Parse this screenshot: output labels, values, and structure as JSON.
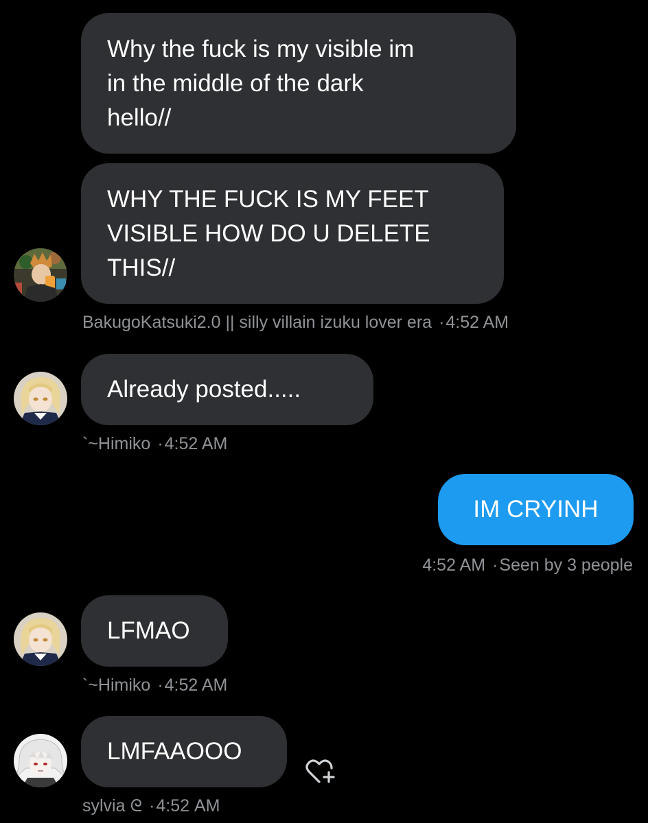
{
  "colors": {
    "background": "#000000",
    "received_bubble": "#2f3033",
    "sent_bubble": "#1d9bf0",
    "meta_text": "#8f9296"
  },
  "messages": [
    {
      "id": "m1",
      "direction": "received",
      "lines": [
        "Why the fuck is my visible im",
        "in the middle of the dark",
        "hello//"
      ]
    },
    {
      "id": "m2",
      "direction": "received",
      "lines": [
        "WHY THE FUCK IS MY FEET",
        "VISIBLE HOW DO U DELETE",
        "THIS//"
      ],
      "avatar_icon": "bakugo-avatar-icon",
      "sender": "BakugoKatsuki2.0 || silly villain izuku lover era",
      "time": "4:52 AM"
    },
    {
      "id": "m3",
      "direction": "received",
      "lines": [
        "Already posted....."
      ],
      "avatar_icon": "himiko-avatar-icon",
      "sender": "`~Himiko",
      "time": "4:52 AM"
    },
    {
      "id": "m4",
      "direction": "sent",
      "lines": [
        "IM CRYINH"
      ],
      "time": "4:52 AM",
      "status": "Seen by 3 people"
    },
    {
      "id": "m5",
      "direction": "received",
      "lines": [
        "LFMAO"
      ],
      "avatar_icon": "himiko-avatar-icon",
      "sender": "`~Himiko",
      "time": "4:52 AM"
    },
    {
      "id": "m6",
      "direction": "received",
      "lines": [
        "LMFAAOOO"
      ],
      "avatar_icon": "sylvia-avatar-icon",
      "sender": "sylvia ᘓ",
      "time": "4:52 AM",
      "reaction_icon": "heart-plus-icon"
    }
  ],
  "separator": "·"
}
